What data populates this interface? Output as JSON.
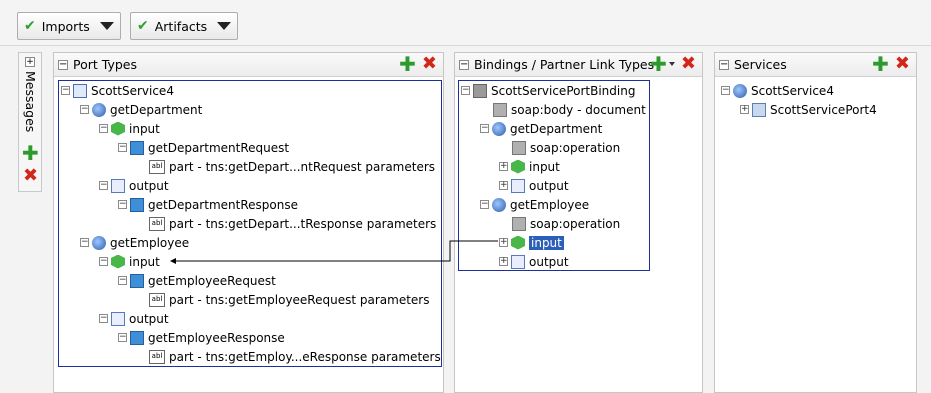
{
  "toolbar": {
    "imports_label": "Imports",
    "artifacts_label": "Artifacts"
  },
  "messages_tab": {
    "label": "Messages"
  },
  "port_types": {
    "title": "Port Types",
    "rows": [
      "ScottService4",
      "getDepartment",
      "input",
      "getDepartmentRequest",
      "part - tns:getDepart...ntRequest parameters",
      "output",
      "getDepartmentResponse",
      "part - tns:getDepart...tResponse parameters",
      "getEmployee",
      "input",
      "getEmployeeRequest",
      "part - tns:getEmployeeRequest parameters",
      "output",
      "getEmployeeResponse",
      "part - tns:getEmploy...eResponse parameters"
    ]
  },
  "bindings": {
    "title": "Bindings / Partner Link Types",
    "rows": [
      "ScottServicePortBinding",
      "soap:body - document",
      "getDepartment",
      "soap:operation",
      "input",
      "output",
      "getEmployee",
      "soap:operation",
      "input",
      "output"
    ]
  },
  "services": {
    "title": "Services",
    "rows": [
      "ScottService4",
      "ScottServicePort4"
    ]
  },
  "colors": {
    "selection": "#2c5fb8",
    "add": "#2c9a2c",
    "delete": "#d3261b",
    "border_highlight": "#1c2f9a"
  },
  "icons": {
    "add": "plus-icon",
    "delete": "x-icon",
    "check": "checkmark-icon",
    "dropdown": "caret-down-icon"
  }
}
